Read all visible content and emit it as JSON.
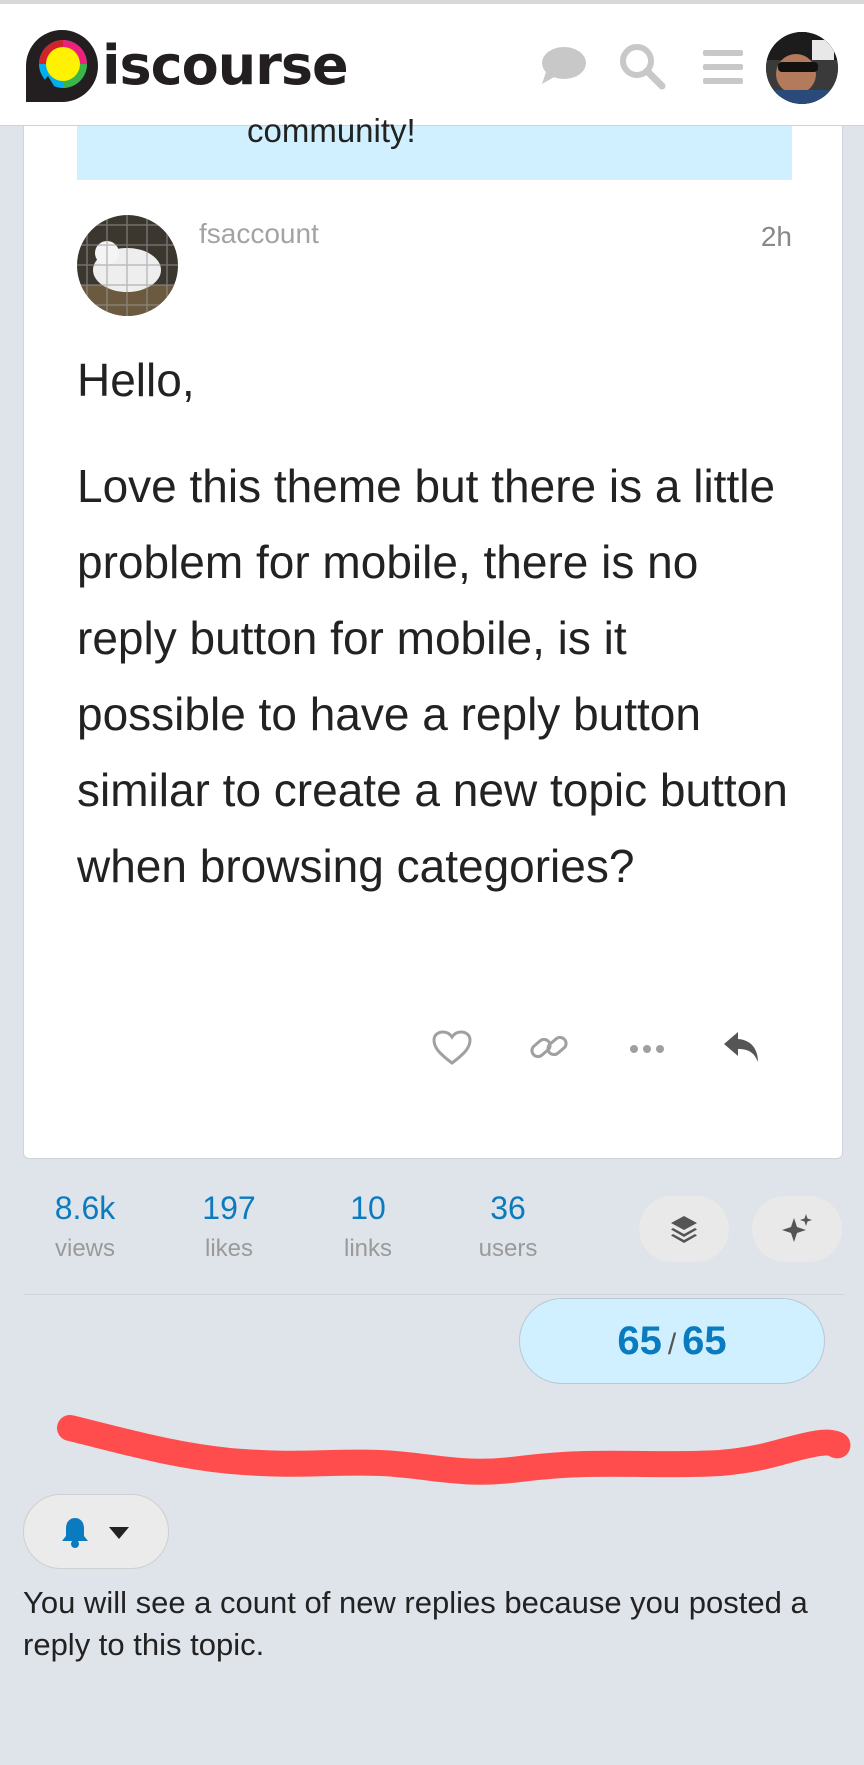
{
  "header": {
    "logo_text": "iscourse",
    "icons": [
      "chat-icon",
      "search-icon",
      "hamburger-menu-icon",
      "user-avatar"
    ]
  },
  "previous_post": {
    "banner_text": "community!"
  },
  "post": {
    "username": "fsaccount",
    "time": "2h",
    "paragraphs": [
      "Hello,",
      "Love this theme but there is a little problem for mobile, there is no reply button for mobile, is it possible to have a reply button similar to create a new topic button when browsing categories?"
    ],
    "actions": [
      "heart-icon",
      "link-icon",
      "more-icon",
      "reply-icon"
    ]
  },
  "stats": [
    {
      "num": "8.6k",
      "label": "views"
    },
    {
      "num": "197",
      "label": "likes"
    },
    {
      "num": "10",
      "label": "links"
    },
    {
      "num": "36",
      "label": "users"
    }
  ],
  "progress": {
    "current": "65",
    "separator": "/",
    "total": "65"
  },
  "notification": {
    "text": "You will see a count of new replies because you posted a reply to this topic."
  },
  "colors": {
    "accent": "#0a7bbf",
    "banner": "#d1f0ff",
    "background": "#dfe3ea",
    "annotation_red": "#ff4d4d"
  }
}
